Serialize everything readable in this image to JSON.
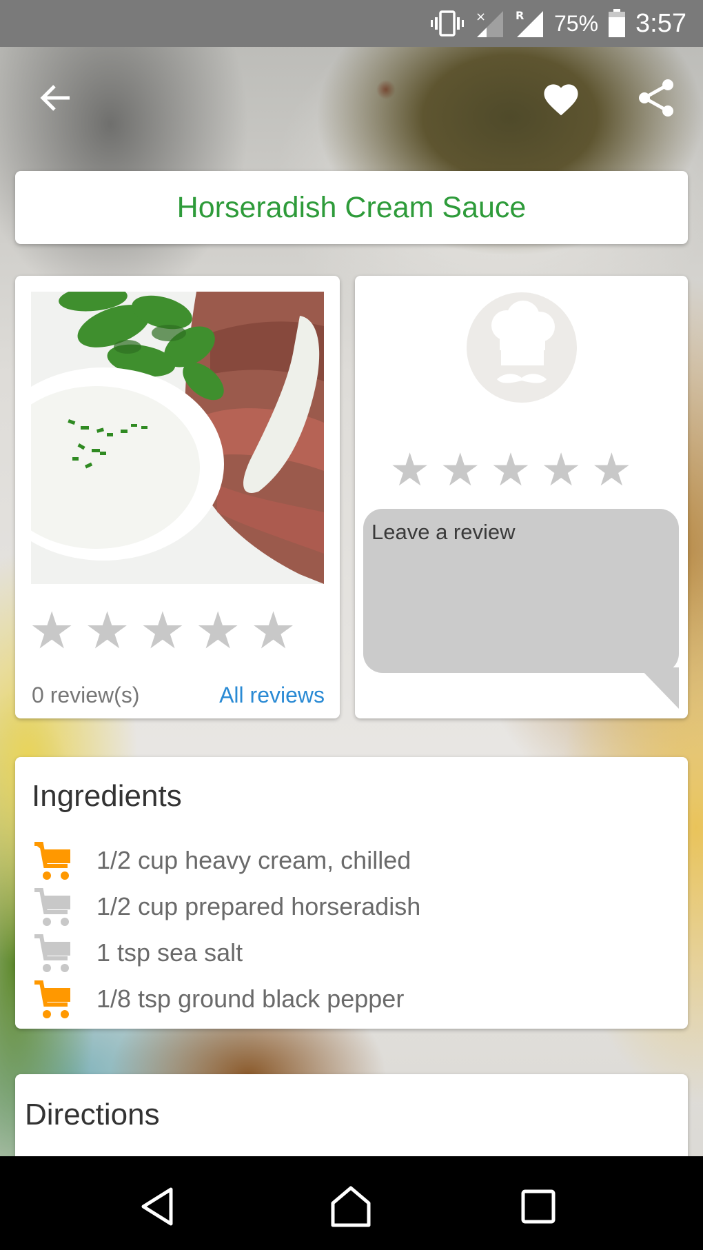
{
  "status_bar": {
    "icons": [
      "vibrate-icon",
      "signal-no-sim-icon",
      "signal-roaming-icon",
      "battery-icon"
    ],
    "roaming_label": "R",
    "no_signal_label": "×",
    "battery_percent": "75%",
    "time": "3:57"
  },
  "toolbar": {
    "back_icon": "arrow-back-icon",
    "favorite_icon": "heart-icon",
    "share_icon": "share-icon"
  },
  "recipe": {
    "title": "Horseradish Cream Sauce",
    "title_color": "#2e9b3a",
    "rating": {
      "stars_total": 5,
      "stars_filled": 0,
      "star_glyph": "★"
    },
    "reviews_count_label": "0 review(s)",
    "all_reviews_label": "All reviews",
    "link_color": "#2a8ad4"
  },
  "review_form": {
    "avatar_icon": "chef-hat-icon",
    "stars_total": 5,
    "stars_selected": 0,
    "star_glyph": "★",
    "placeholder": "Leave a review",
    "value": ""
  },
  "ingredients": {
    "title": "Ingredients",
    "accent_color": "#ff9800",
    "inactive_color": "#c8c8c8",
    "items": [
      {
        "text": "1/2 cup heavy cream, chilled",
        "in_cart": true
      },
      {
        "text": "1/2 cup prepared horseradish",
        "in_cart": false
      },
      {
        "text": "1 tsp sea salt",
        "in_cart": false
      },
      {
        "text": "1/8 tsp ground black pepper",
        "in_cart": true
      }
    ]
  },
  "directions": {
    "title": "Directions"
  },
  "nav_bar": {
    "buttons": [
      "nav-back-icon",
      "nav-home-icon",
      "nav-recents-icon"
    ]
  }
}
